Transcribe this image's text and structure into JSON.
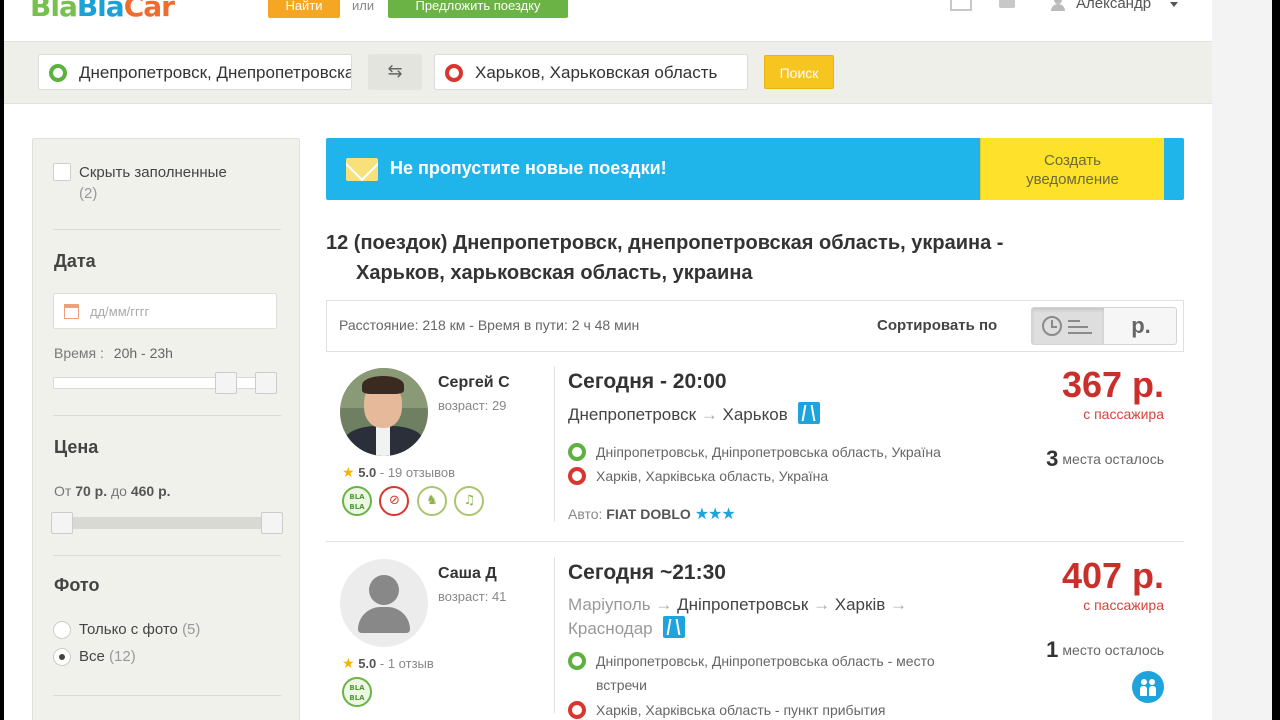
{
  "header": {
    "logo": {
      "part1": "Bla",
      "part2": "Bla",
      "part3": "Car"
    },
    "find_label": "Найти",
    "or_label": "или",
    "offer_label": "Предложить поездку",
    "user_name": "Александр"
  },
  "search": {
    "from_value": "Днепропетровск, Днепропетровская область",
    "to_value": "Харьков, Харьковская область",
    "swap_glyph": "⇆",
    "search_label": "Поиск"
  },
  "sidebar": {
    "hide_full_label": "Скрыть заполненные",
    "hide_full_count": "(2)",
    "date_title": "Дата",
    "date_placeholder": "дд/мм/гггг",
    "time_prefix": "Время :",
    "time_range": "20h - 23h",
    "price_title": "Цена",
    "price_from_word": "От",
    "price_min": "70 р.",
    "price_to_word": "до",
    "price_max": "460 р.",
    "photo_title": "Фото",
    "photo_options": [
      {
        "label": "Только с фото",
        "count": "(5)",
        "selected": false
      },
      {
        "label": "Все",
        "count": "(12)",
        "selected": true
      }
    ]
  },
  "alert": {
    "text": "Не пропустите новые поездки!",
    "button_line1": "Создать",
    "button_line2": "уведомление"
  },
  "results": {
    "title_line1": "12 (поездок) Днепропетровск, днепропетровская область, украина -",
    "title_line2": "Харьков, харьковская область, украина",
    "info": "Расстояние: 218 км - Время в пути: 2 ч 48 мин",
    "sort_label": "Сортировать по",
    "sort_price_label": "р."
  },
  "trips": [
    {
      "driver_name": "Сергей С",
      "driver_age": "возраст: 29",
      "rating": "5.0",
      "reviews": "- 19 отзывов",
      "time": "Сегодня - 20:00",
      "route_from": "Днепропетровск",
      "route_to": "Харьков",
      "stop_from": "Дніпропетровськ, Дніпропетровська область, Україна",
      "stop_to": "Харків, Харківська область, Україна",
      "car_prefix": "Авто:",
      "car_model": "FIAT DOBLO",
      "car_stars": "★★★",
      "price": "367 р.",
      "price_note": "с пассажира",
      "seats_count": "3",
      "seats_text": "места осталось"
    },
    {
      "driver_name": "Саша Д",
      "driver_age": "возраст: 41",
      "rating": "5.0",
      "reviews": "- 1 отзыв",
      "time": "Сегодня ~21:30",
      "route_start": "Маріуполь",
      "route_from": "Дніпропетровськ",
      "route_to": "Харків",
      "route_end": "Краснодар",
      "stop_from": "Дніпропетровськ, Дніпропетровська область - место встречи",
      "stop_to": "Харків, Харківська область - пункт прибытия",
      "price": "407 р.",
      "price_note": "с пассажира",
      "seats_count": "1",
      "seats_text": "место осталось"
    }
  ],
  "icons": {
    "arrow": "→",
    "star": "★",
    "no_smoking": "⊘",
    "pet": "♞",
    "music": "♫"
  },
  "colors": {
    "brand_green": "#6bb344",
    "brand_orange": "#f5a623",
    "alert_blue": "#1fb4ea",
    "alert_yellow": "#fde12a",
    "price_red": "#c9302c"
  }
}
